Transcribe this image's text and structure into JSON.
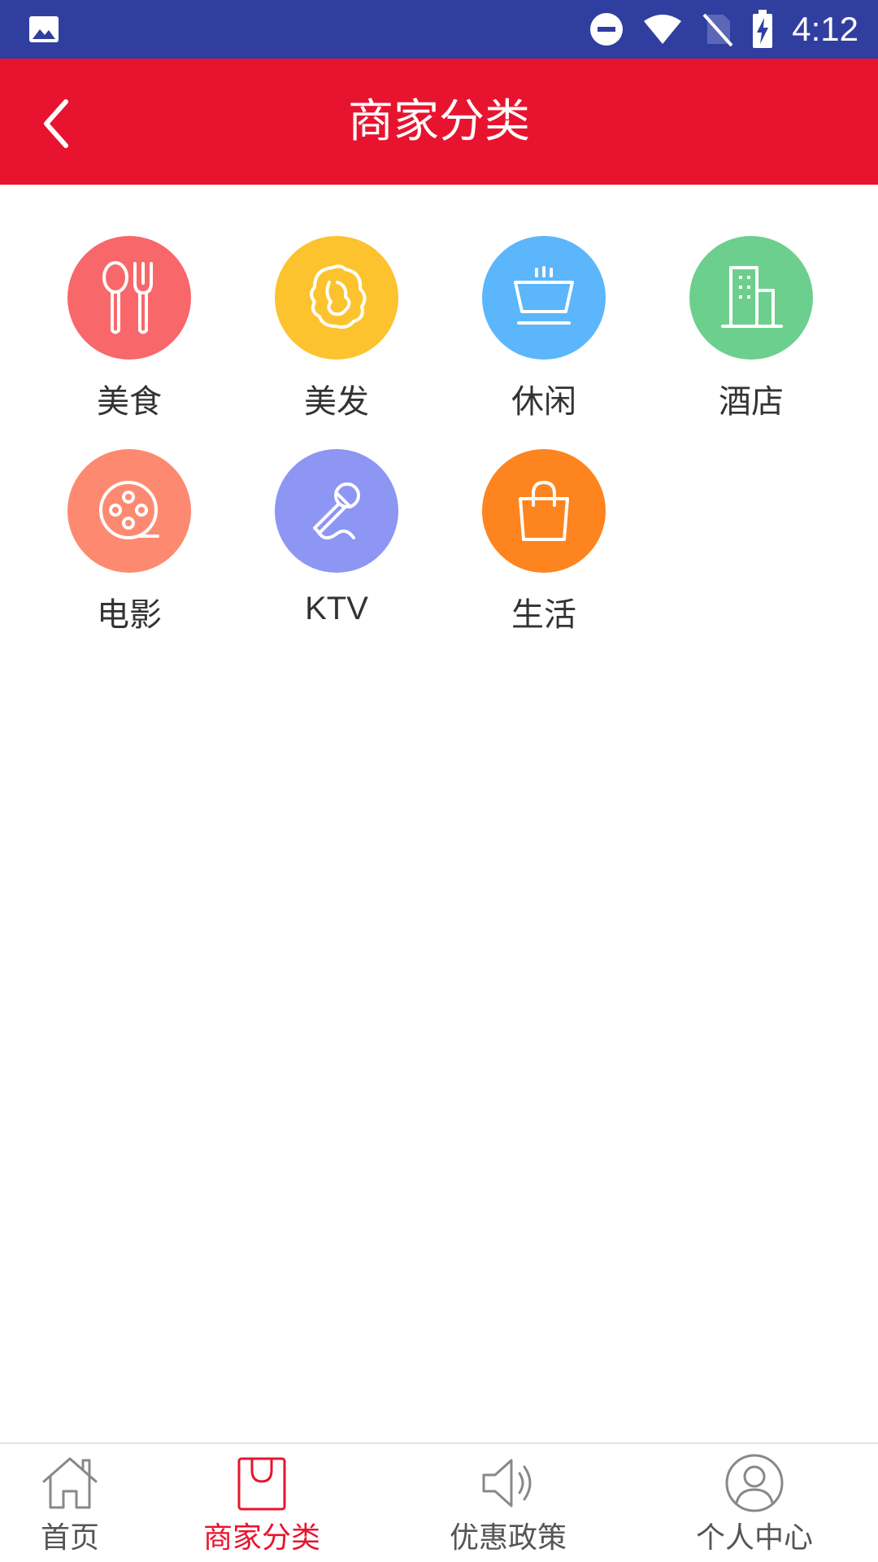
{
  "status_bar": {
    "time": "4:12",
    "icons": [
      "image-icon",
      "dnd-icon",
      "wifi-icon",
      "no-sim-icon",
      "battery-charging-icon"
    ]
  },
  "header": {
    "title": "商家分类",
    "back_icon": "chevron-left-icon"
  },
  "categories": [
    {
      "label": "美食",
      "icon": "utensils-icon",
      "color": "#f8676a"
    },
    {
      "label": "美发",
      "icon": "hair-icon",
      "color": "#fcc32e"
    },
    {
      "label": "休闲",
      "icon": "bowl-icon",
      "color": "#5bb6fb"
    },
    {
      "label": "酒店",
      "icon": "building-icon",
      "color": "#6dcf8e"
    },
    {
      "label": "电影",
      "icon": "film-reel-icon",
      "color": "#fd8a70"
    },
    {
      "label": "KTV",
      "icon": "microphone-icon",
      "color": "#8d96f3"
    },
    {
      "label": "生活",
      "icon": "shopping-bag-icon",
      "color": "#fd841f"
    }
  ],
  "bottom_nav": {
    "active_color": "#e8142f",
    "items": [
      {
        "label": "首页",
        "icon": "home-icon"
      },
      {
        "label": "商家分类",
        "icon": "bag-icon",
        "active": true
      },
      {
        "label": "优惠政策",
        "icon": "speaker-icon"
      },
      {
        "label": "个人中心",
        "icon": "user-icon"
      }
    ]
  }
}
